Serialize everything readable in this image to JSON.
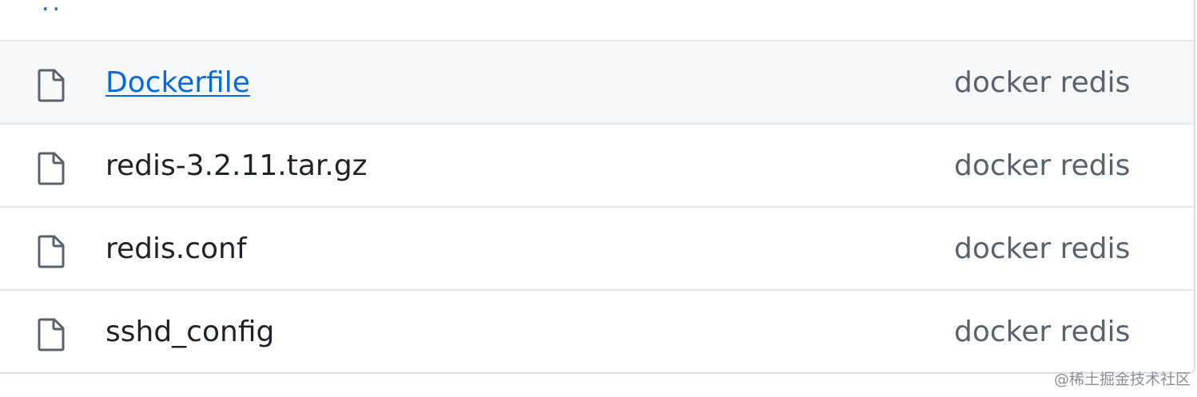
{
  "parent_dir": {
    "label": ".."
  },
  "files": [
    {
      "name": "Dockerfile",
      "commit_message": "docker redis",
      "icon": "file-icon",
      "hovered": true
    },
    {
      "name": "redis-3.2.11.tar.gz",
      "commit_message": "docker redis",
      "icon": "file-icon",
      "hovered": false
    },
    {
      "name": "redis.conf",
      "commit_message": "docker redis",
      "icon": "file-icon",
      "hovered": false
    },
    {
      "name": "sshd_config",
      "commit_message": "docker redis",
      "icon": "file-icon",
      "hovered": false
    }
  ],
  "watermark": "@稀土掘金技术社区",
  "colors": {
    "link": "#0969da",
    "text": "#1f2328",
    "muted": "#59636e",
    "hover_bg": "#f6f8fa",
    "border": "#e4e8ec"
  }
}
